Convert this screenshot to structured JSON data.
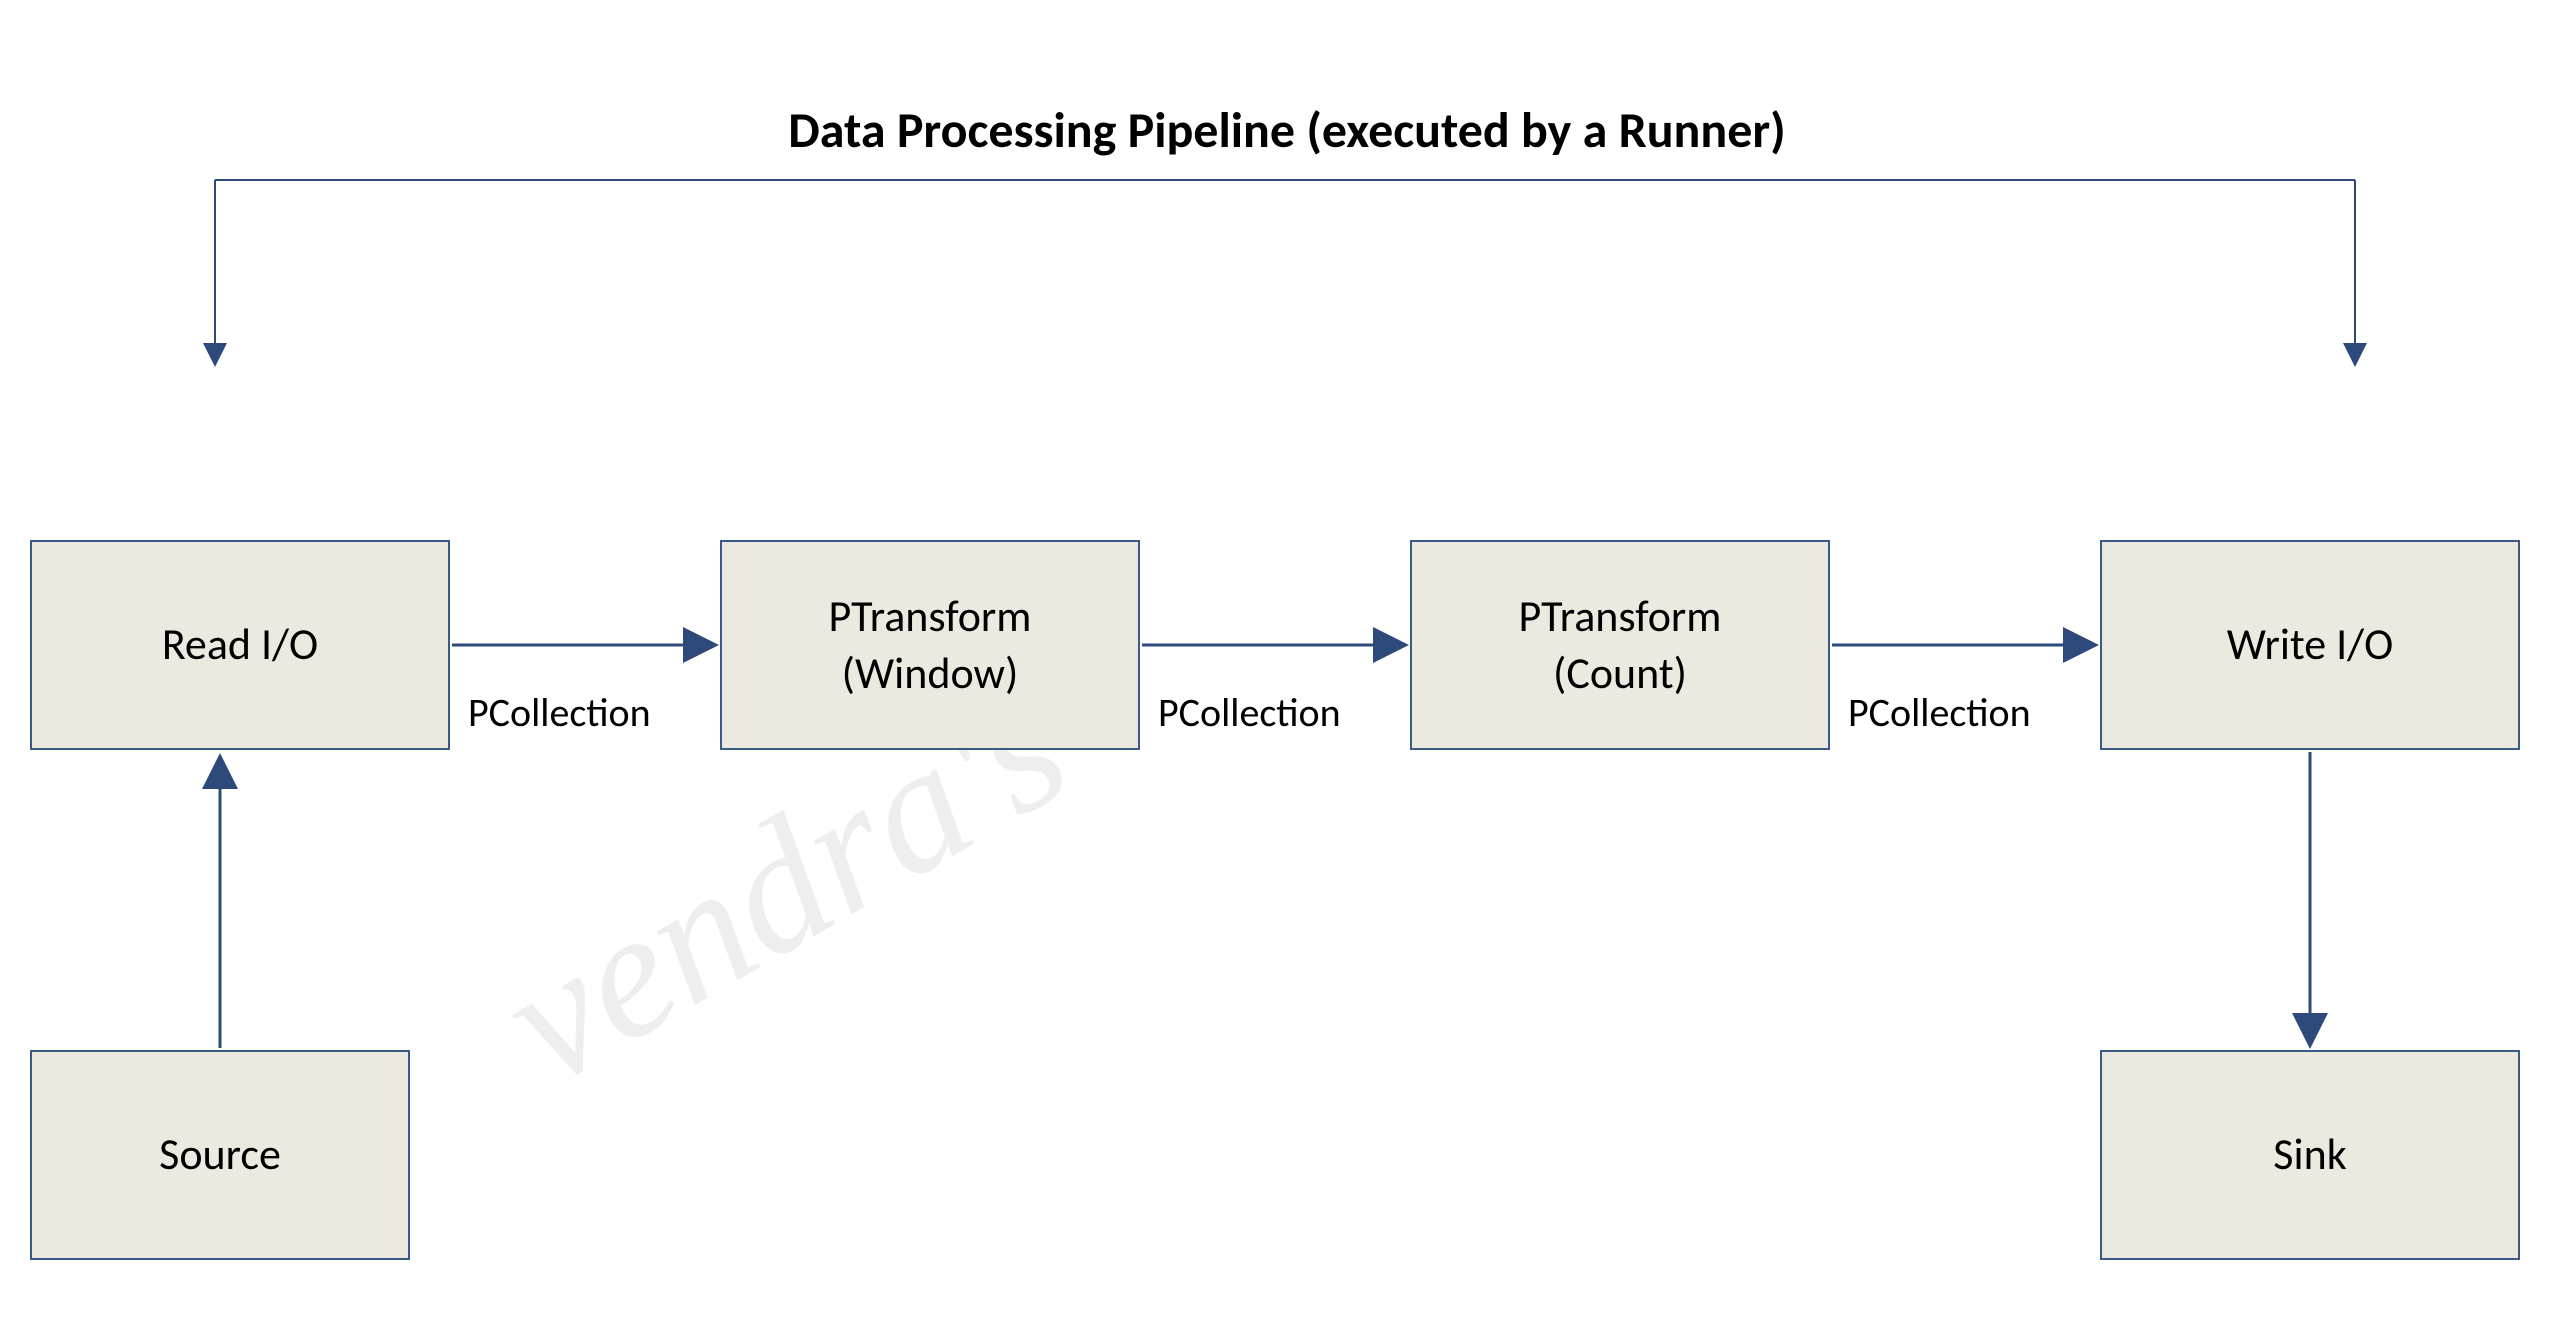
{
  "title": "Data Processing Pipeline (executed by a Runner)",
  "boxes": {
    "read": "Read I/O",
    "window": "PTransform\n(Window)",
    "count": "PTransform\n(Count)",
    "write": "Write I/O",
    "source": "Source",
    "sink": "Sink"
  },
  "labels": {
    "pcollection1": "PCollection",
    "pcollection2": "PCollection",
    "pcollection3": "PCollection"
  },
  "watermark": "vendra's"
}
